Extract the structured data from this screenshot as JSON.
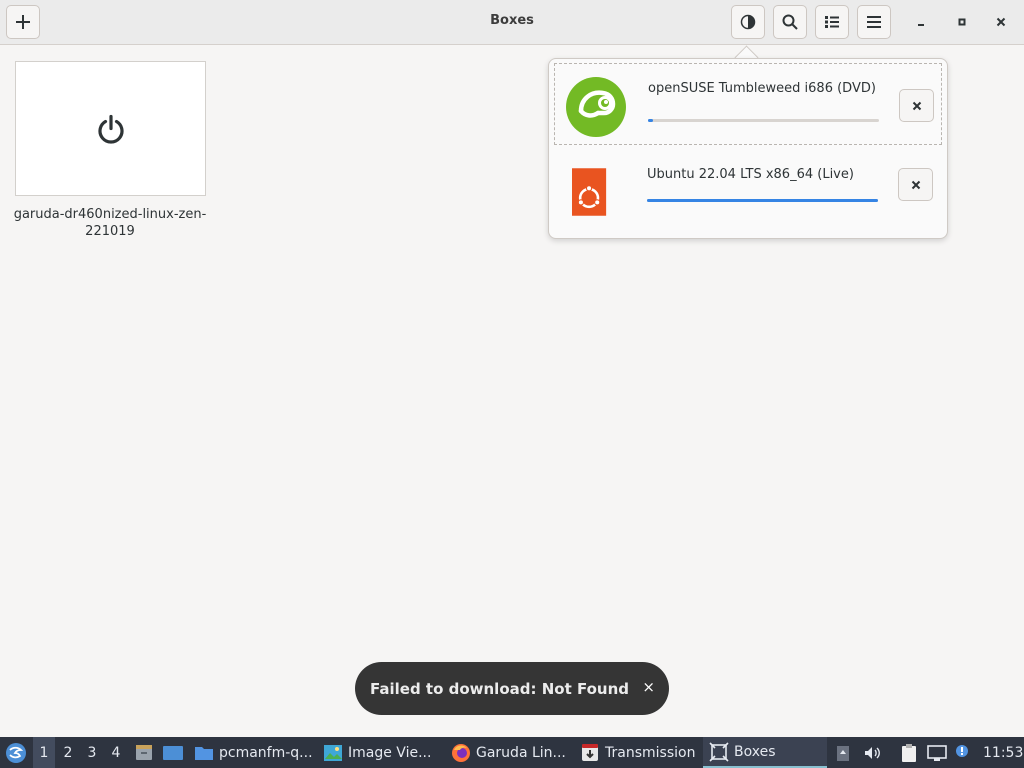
{
  "window": {
    "title": "Boxes"
  },
  "header": {
    "new_button_icon": "plus-icon",
    "buttons": [
      "contrast-icon",
      "search-icon",
      "list-view-icon",
      "menu-icon"
    ],
    "window_controls": [
      "minimize-icon",
      "maximize-icon",
      "close-icon"
    ]
  },
  "library": {
    "items": [
      {
        "name": "garuda-dr460nized-linux-zen-221019",
        "icon": "power-icon"
      }
    ]
  },
  "downloads": [
    {
      "title": "openSUSE Tumbleweed i686 (DVD)",
      "progress": 0.02,
      "logo": "opensuse-logo",
      "cancel": "×"
    },
    {
      "title": "Ubuntu 22.04 LTS x86_64 (Live)",
      "progress": 1.0,
      "logo": "ubuntu-logo",
      "cancel": "×"
    }
  ],
  "toast": {
    "message": "Failed to download: Not Found",
    "close": "×"
  },
  "taskbar": {
    "workspaces": [
      "1",
      "2",
      "3",
      "4"
    ],
    "active_workspace": "1",
    "tasks": [
      {
        "label": "pcmanfm-q...",
        "icon": "folder-icon"
      },
      {
        "label": "Image Vie...",
        "icon": "image-viewer-icon"
      },
      {
        "label": "Garuda Lin...",
        "icon": "firefox-icon"
      },
      {
        "label": "Transmission",
        "icon": "transmission-icon"
      },
      {
        "label": "Boxes",
        "icon": "boxes-icon"
      }
    ],
    "clock": "11:53"
  },
  "colors": {
    "accent": "#3584e4",
    "opensuse_green": "#73ba25",
    "ubuntu_orange": "#e95420",
    "taskbar_bg": "#2e3440"
  }
}
